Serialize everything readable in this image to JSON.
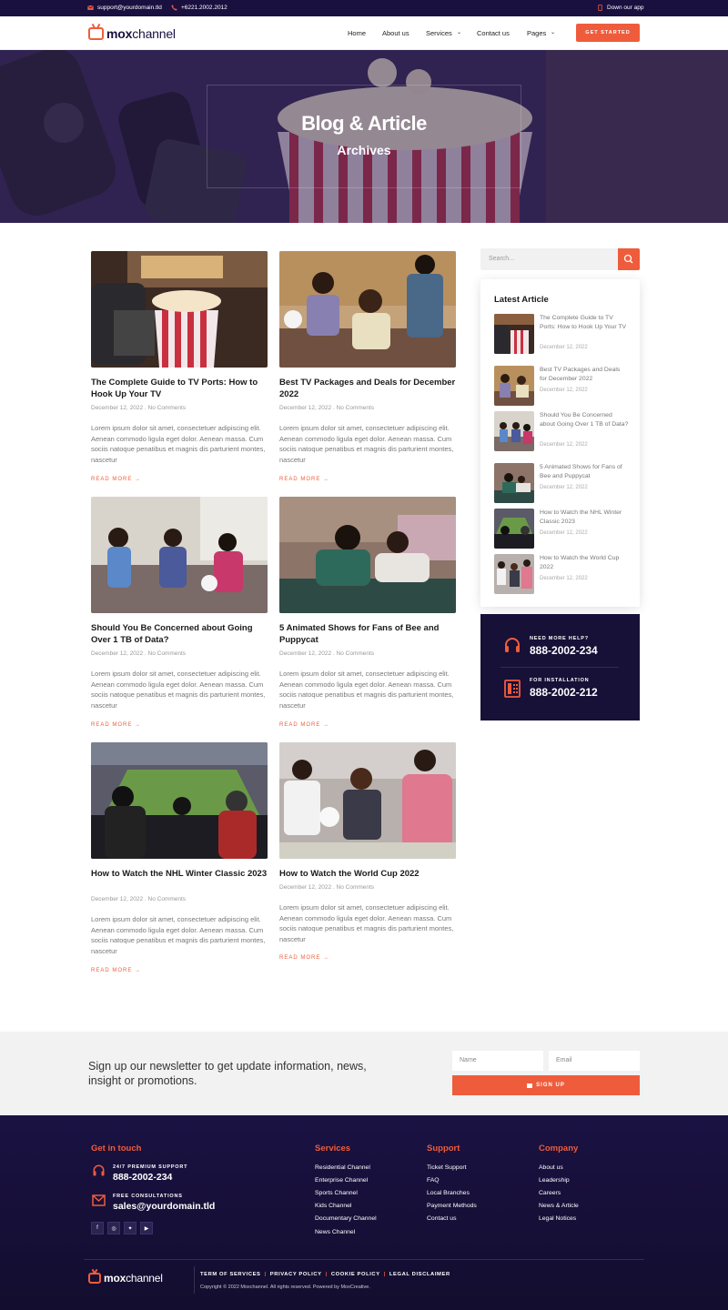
{
  "topbar": {
    "email": "support@yourdomain.tld",
    "phone": "+6221.2002.2012",
    "app": "Down our app"
  },
  "header": {
    "logo_bold": "mox",
    "logo_rest": "channel",
    "nav": [
      "Home",
      "About us",
      "Services",
      "Contact us",
      "Pages"
    ],
    "cta": "GET STARTED"
  },
  "hero": {
    "title": "Blog & Article",
    "subtitle": "Archives"
  },
  "posts": [
    {
      "title": "The Complete Guide to TV Ports: How to Hook Up Your TV",
      "date": "December 12, 2022",
      "comments": "No Comments",
      "excerpt": "Lorem ipsum dolor sit amet, consectetuer adipiscing elit. Aenean commodo ligula eget dolor. Aenean massa. Cum sociis natoque penatibus et magnis dis parturient montes, nascetur",
      "more": "READ MORE →"
    },
    {
      "title": "Best TV Packages and Deals for December 2022",
      "date": "December 12, 2022",
      "comments": "No Comments",
      "excerpt": "Lorem ipsum dolor sit amet, consectetuer adipiscing elit. Aenean commodo ligula eget dolor. Aenean massa. Cum sociis natoque penatibus et magnis dis parturient montes, nascetur",
      "more": "READ MORE →"
    },
    {
      "title": "Should You Be Concerned about Going Over 1 TB of Data?",
      "date": "December 12, 2022",
      "comments": "No Comments",
      "excerpt": "Lorem ipsum dolor sit amet, consectetuer adipiscing elit. Aenean commodo ligula eget dolor. Aenean massa. Cum sociis natoque penatibus et magnis dis parturient montes, nascetur",
      "more": "READ MORE →"
    },
    {
      "title": "5 Animated Shows for Fans of Bee and Puppycat",
      "date": "December 12, 2022",
      "comments": "No Comments",
      "excerpt": "Lorem ipsum dolor sit amet, consectetuer adipiscing elit. Aenean commodo ligula eget dolor. Aenean massa. Cum sociis natoque penatibus et magnis dis parturient montes, nascetur",
      "more": "READ MORE →"
    },
    {
      "title": "How to Watch the NHL Winter Classic 2023",
      "date": "December 12, 2022",
      "comments": "No Comments",
      "excerpt": "Lorem ipsum dolor sit amet, consectetuer adipiscing elit. Aenean commodo ligula eget dolor. Aenean massa. Cum sociis natoque penatibus et magnis dis parturient montes, nascetur",
      "more": "READ MORE →"
    },
    {
      "title": "How to Watch the World Cup 2022",
      "date": "December 12, 2022",
      "comments": "No Comments",
      "excerpt": "Lorem ipsum dolor sit amet, consectetuer adipiscing elit. Aenean commodo ligula eget dolor. Aenean massa. Cum sociis natoque penatibus et magnis dis parturient montes, nascetur",
      "more": "READ MORE →"
    }
  ],
  "sidebar": {
    "search_placeholder": "Search...",
    "latest_title": "Latest Article",
    "latest": [
      {
        "title": "The Complete Guide to TV Ports: How to Hook Up Your TV",
        "date": "December 12, 2022"
      },
      {
        "title": "Best TV Packages and Deals for December 2022",
        "date": "December 12, 2022"
      },
      {
        "title": "Should You Be Concerned about Going Over 1 TB of Data?",
        "date": "December 12, 2022"
      },
      {
        "title": "5 Animated Shows for Fans of Bee and Puppycat",
        "date": "December 12, 2022"
      },
      {
        "title": "How to Watch the NHL Winter Classic 2023",
        "date": "December 12, 2022"
      },
      {
        "title": "How to Watch the World Cup 2022",
        "date": "December 12, 2022"
      }
    ],
    "help_label": "NEED MORE HELP?",
    "help_number": "888-2002-234",
    "install_label": "FOR INSTALLATION",
    "install_number": "888-2002-212"
  },
  "newsletter": {
    "text": "Sign up our newsletter to get update information, news, insight or promotions.",
    "name_placeholder": "Name",
    "email_placeholder": "Email",
    "button": "SIGN UP"
  },
  "footer": {
    "get_in_touch": "Get in touch",
    "support_label": "24/7 PREMIUM SUPPORT",
    "support_number": "888-2002-234",
    "consult_label": "FREE CONSULTATIONS",
    "consult_email": "sales@yourdomain.tld",
    "services_title": "Services",
    "services": [
      "Residential Channel",
      "Enterprise Channel",
      "Sports Channel",
      "Kids Channel",
      "Documentary Channel",
      "News Channel"
    ],
    "support_title": "Support",
    "support": [
      "Ticket Support",
      "FAQ",
      "Local Branches",
      "Payment Methods",
      "Contact us"
    ],
    "company_title": "Company",
    "company": [
      "About us",
      "Leadership",
      "Careers",
      "News & Article",
      "Legal Notices"
    ],
    "legal": [
      "TERM OF SERVICES",
      "PRIVACY POLICY",
      "COOKIE POLICY",
      "LEGAL DISCLAIMER"
    ],
    "copyright": "Copyright © 2022 Moxchannel. All rights reserved. Powered by MoxCreative."
  },
  "colors": {
    "accent": "#ef5c3c",
    "navy": "#1a1040"
  }
}
